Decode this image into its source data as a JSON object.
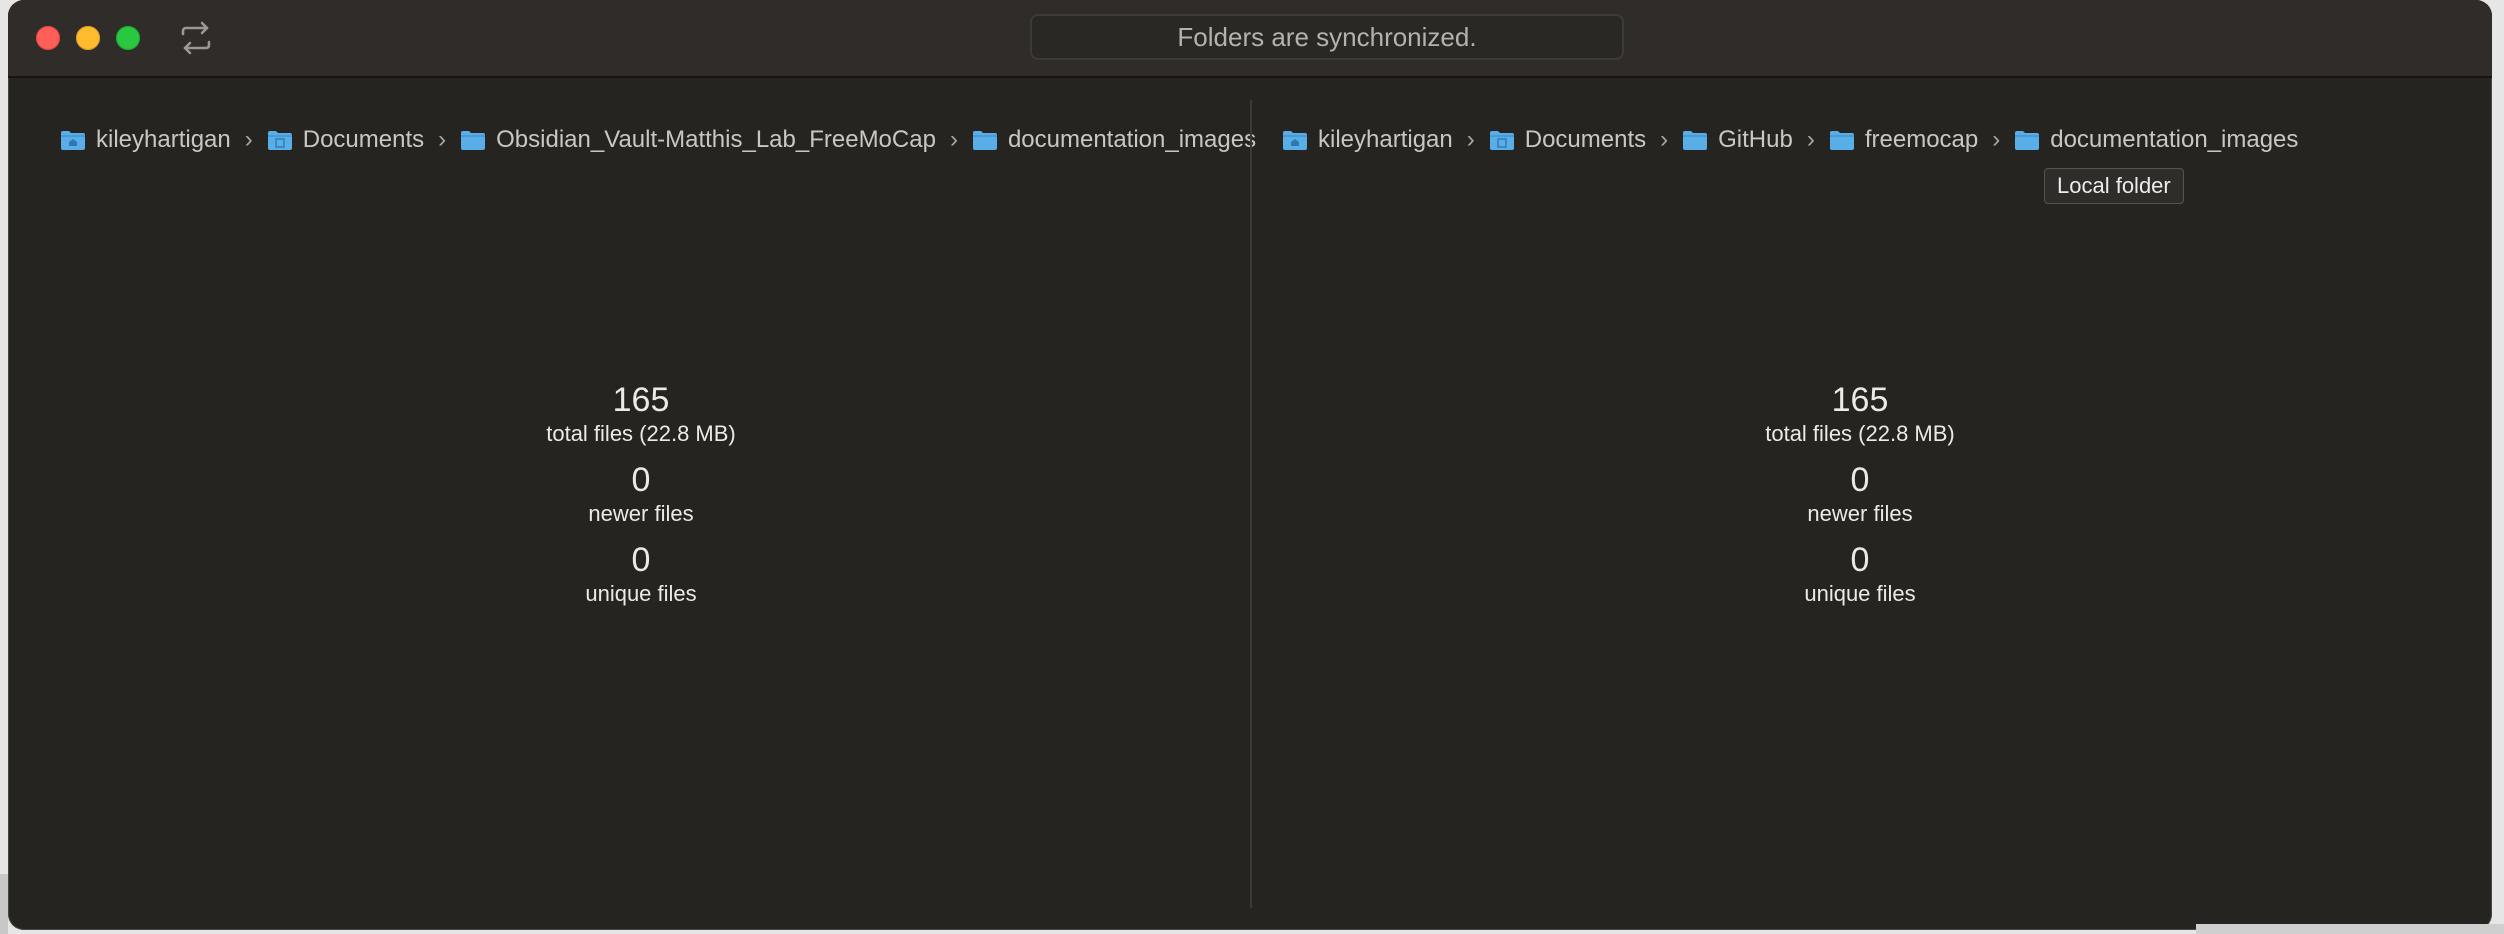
{
  "status_text": "Folders are synchronized.",
  "left_breadcrumb": [
    "kileyhartigan",
    "Documents",
    "Obsidian_Vault-Matthis_Lab_FreeMoCap",
    "documentation_images"
  ],
  "right_breadcrumb": [
    "kileyhartigan",
    "Documents",
    "GitHub",
    "freemocap",
    "documentation_images"
  ],
  "tooltip": "Local folder",
  "left_stats": {
    "total_count": "165",
    "total_label": "total files (22.8 MB)",
    "newer_count": "0",
    "newer_label": "newer files",
    "unique_count": "0",
    "unique_label": "unique files"
  },
  "right_stats": {
    "total_count": "165",
    "total_label": "total files (22.8 MB)",
    "newer_count": "0",
    "newer_label": "newer files",
    "unique_count": "0",
    "unique_label": "unique files"
  },
  "icons": {
    "sync": "sync-arrows-icon",
    "folder": "folder-icon",
    "home_folder": "home-folder-icon"
  },
  "colors": {
    "folder_blue": "#5aaee8",
    "close": "#ff5f57",
    "minimize": "#febc2e",
    "maximize": "#28c840"
  }
}
